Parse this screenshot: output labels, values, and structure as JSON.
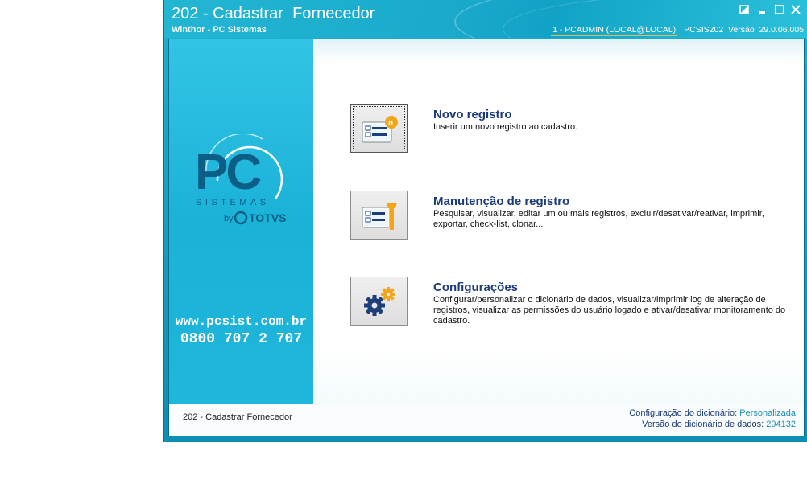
{
  "window": {
    "title": "202 - Cadastrar  Fornecedor",
    "subtitle": "Winthor - PC Sistemas",
    "user": "1 - PCADMIN (LOCAL@LOCAL)",
    "program_version": "PCSIS202  Versão  29.0.06.005"
  },
  "brand": {
    "logo_text": "PC",
    "logo_sub": "SISTEMAS",
    "by_text": "by",
    "partner": "TOTVS",
    "url": "www.pcsist.com.br",
    "phone": "0800 707 2 707"
  },
  "actions": [
    {
      "title": "Novo registro",
      "description": "Inserir um novo registro ao cadastro.",
      "icon": "new-record-icon"
    },
    {
      "title": "Manutenção de registro",
      "description": "Pesquisar, visualizar, editar um ou mais registros, excluir/desativar/reativar, imprimir, exportar, check-list,  clonar...",
      "icon": "maintenance-icon"
    },
    {
      "title": "Configurações",
      "description": "Configurar/personalizar o dicionário de dados, visualizar/imprimir log de alteração de registros, visualizar as permissões do usuário logado e ativar/desativar monitoramento do cadastro.",
      "icon": "settings-gears-icon"
    }
  ],
  "status": {
    "left": "202 - Cadastrar  Fornecedor",
    "dict_config_label": "Configuração do dicionário:",
    "dict_config_value": "Personalizada",
    "dict_version_label": "Versão do dicionário de dados:",
    "dict_version_value": "294132"
  },
  "colors": {
    "accent": "#1aa9cb",
    "title_blue": "#1b3a78",
    "status_value": "#1a8cb0"
  }
}
